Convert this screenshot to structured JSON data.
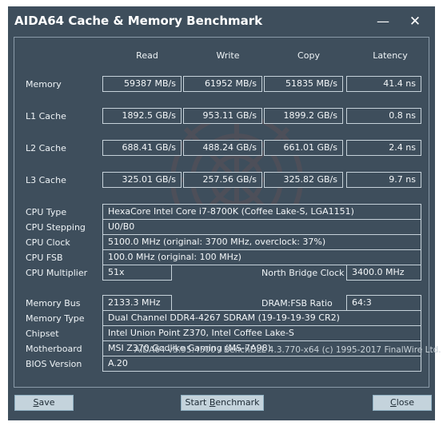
{
  "window": {
    "title": "AIDA64 Cache & Memory Benchmark",
    "minimize_glyph": "—",
    "close_glyph": "✕"
  },
  "columns": [
    "Read",
    "Write",
    "Copy",
    "Latency"
  ],
  "bench_rows": [
    {
      "label": "Memory",
      "read": "59387 MB/s",
      "write": "61952 MB/s",
      "copy": "51835 MB/s",
      "latency": "41.4 ns"
    },
    {
      "label": "L1 Cache",
      "read": "1892.5 GB/s",
      "write": "953.11 GB/s",
      "copy": "1899.2 GB/s",
      "latency": "0.8 ns"
    },
    {
      "label": "L2 Cache",
      "read": "688.41 GB/s",
      "write": "488.24 GB/s",
      "copy": "661.01 GB/s",
      "latency": "2.4 ns"
    },
    {
      "label": "L3 Cache",
      "read": "325.01 GB/s",
      "write": "257.56 GB/s",
      "copy": "325.82 GB/s",
      "latency": "9.7 ns"
    }
  ],
  "cpu": {
    "type_label": "CPU Type",
    "type_value": "HexaCore Intel Core i7-8700K  (Coffee Lake-S, LGA1151)",
    "stepping_label": "CPU Stepping",
    "stepping_value": "U0/B0",
    "clock_label": "CPU Clock",
    "clock_value": "5100.0 MHz  (original: 3700 MHz, overclock: 37%)",
    "fsb_label": "CPU FSB",
    "fsb_value": "100.0 MHz  (original: 100 MHz)",
    "multiplier_label": "CPU Multiplier",
    "multiplier_value": "51x",
    "nb_clock_label": "North Bridge Clock",
    "nb_clock_value": "3400.0 MHz"
  },
  "memory": {
    "bus_label": "Memory Bus",
    "bus_value": "2133.3 MHz",
    "ratio_label": "DRAM:FSB Ratio",
    "ratio_value": "64:3",
    "type_label": "Memory Type",
    "type_value": "Dual Channel DDR4-4267 SDRAM  (19-19-19-39 CR2)",
    "chipset_label": "Chipset",
    "chipset_value": "Intel Union Point Z370, Intel Coffee Lake-S",
    "motherboard_label": "Motherboard",
    "motherboard_value": "MSI Z370 Godlike Gaming (MS-7A98)",
    "bios_label": "BIOS Version",
    "bios_value": "A.20"
  },
  "footer": "AIDA64 v5.95.4500 / BenchDLL 4.3.770-x64  (c) 1995-2017 FinalWire Ltd.",
  "buttons": {
    "save_first": "S",
    "save_rest": "ave",
    "start_pre": "Start ",
    "start_ul": "B",
    "start_post": "enchmark",
    "close_first": "C",
    "close_rest": "lose"
  },
  "colors": {
    "window_bg": "#3e4e5c",
    "button_bg": "#c4d3dc",
    "text": "#eef3f6"
  }
}
